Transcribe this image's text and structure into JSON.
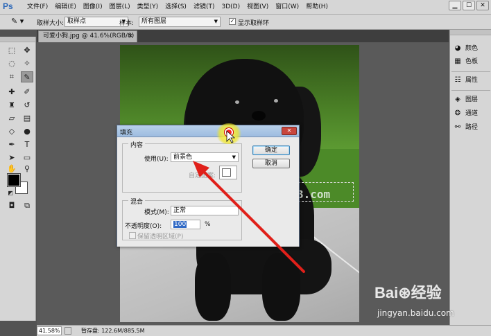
{
  "app": {
    "logo": "Ps"
  },
  "menu": [
    "文件(F)",
    "编辑(E)",
    "图像(I)",
    "图层(L)",
    "类型(Y)",
    "选择(S)",
    "滤镜(T)",
    "3D(D)",
    "视图(V)",
    "窗口(W)",
    "帮助(H)"
  ],
  "window_controls": {
    "minimize": "▁",
    "maximize": "☐",
    "close": "✕"
  },
  "options": {
    "sample_size_label": "取样大小:",
    "sample_size_value": "取样点",
    "sample_label": "样本:",
    "sample_value": "所有图层",
    "show_ring_label": "显示取样环",
    "show_ring_checked": "✓"
  },
  "document": {
    "tab_title": "可爱小狗.jpg @ 41.6%(RGB/8)",
    "close": "×"
  },
  "photo_watermark": "3.com",
  "panels": {
    "items": [
      {
        "label": "颜色",
        "icon": "palette-icon"
      },
      {
        "label": "色板",
        "icon": "swatches-icon"
      },
      {
        "label": "属性",
        "icon": "properties-icon"
      },
      {
        "label": "图层",
        "icon": "layers-icon"
      },
      {
        "label": "通道",
        "icon": "channels-icon"
      },
      {
        "label": "路径",
        "icon": "paths-icon"
      }
    ]
  },
  "status": {
    "zoom": "41.58%",
    "info": "暂存盘: 122.6M/885.5M"
  },
  "fill_dialog": {
    "title": "填充",
    "contents_group": "内容",
    "use_label": "使用(U):",
    "use_value": "前景色",
    "custom_pattern_label": "自定图案:",
    "blending_group": "混合",
    "mode_label": "模式(M):",
    "mode_value": "正常",
    "opacity_label": "不透明度(O):",
    "opacity_value": "100",
    "opacity_unit": "%",
    "preserve_label": "保留透明区域(P)",
    "ok_label": "确定",
    "cancel_label": "取消",
    "close": "✕"
  },
  "watermark": {
    "brand": "Bai⊛经验",
    "url": "jingyan.baidu.com"
  },
  "colors": {
    "accent": "#2b67b8",
    "annotation_arrow": "#e0201a",
    "highlight": "#f4ea2a",
    "foreground": "#000000",
    "background": "#ffffff"
  }
}
